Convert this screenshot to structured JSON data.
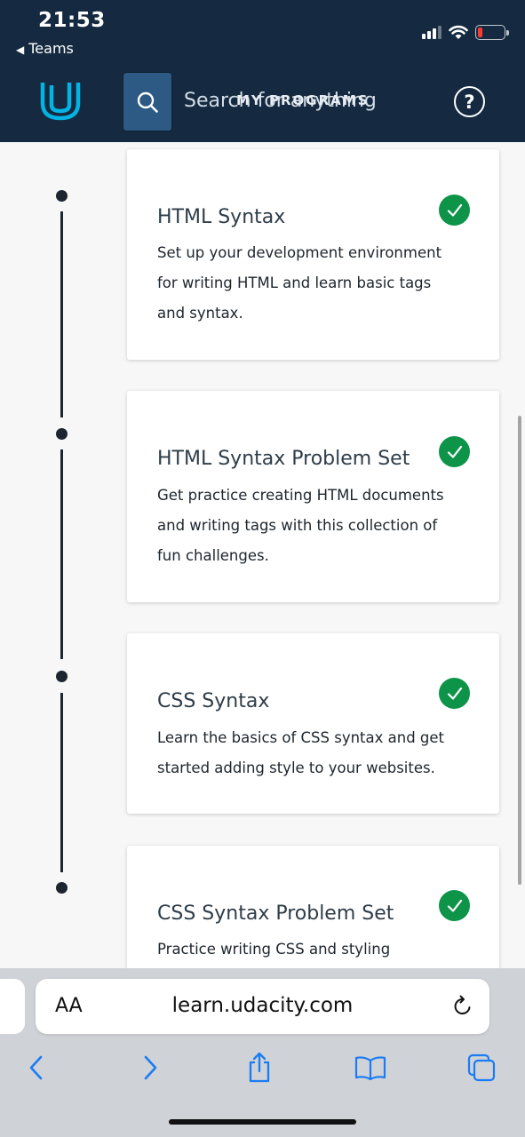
{
  "status_bar": {
    "time": "21:53",
    "back_app": "Teams"
  },
  "header": {
    "search_placeholder": "Search for anything",
    "program_title": "MY PROGRAMS",
    "help_symbol": "?"
  },
  "lessons": [
    {
      "title": "HTML Syntax",
      "description": "Set up your development environment for writing HTML and learn basic tags and syntax.",
      "completed": true
    },
    {
      "title": "HTML Syntax Problem Set",
      "description": "Get practice creating HTML documents and writing tags with this collection of fun challenges.",
      "completed": true
    },
    {
      "title": "CSS Syntax",
      "description": "Learn the basics of CSS syntax and get started adding style to your websites.",
      "completed": true
    },
    {
      "title": "CSS Syntax Problem Set",
      "description": "Practice writing CSS and styling",
      "completed": true
    }
  ],
  "browser": {
    "text_size_label": "AA",
    "url": "learn.udacity.com"
  },
  "icons": {
    "logo": "udacity-logo-icon",
    "search": "search-icon",
    "help": "help-icon",
    "check": "check-circle-icon",
    "reload": "reload-icon",
    "back": "chevron-left-icon",
    "forward": "chevron-right-icon",
    "share": "share-icon",
    "bookmarks": "book-icon",
    "tabs": "tabs-icon"
  },
  "colors": {
    "header_bg": "#152a40",
    "check_green": "#0d9448",
    "logo_blue": "#02b3e4"
  }
}
